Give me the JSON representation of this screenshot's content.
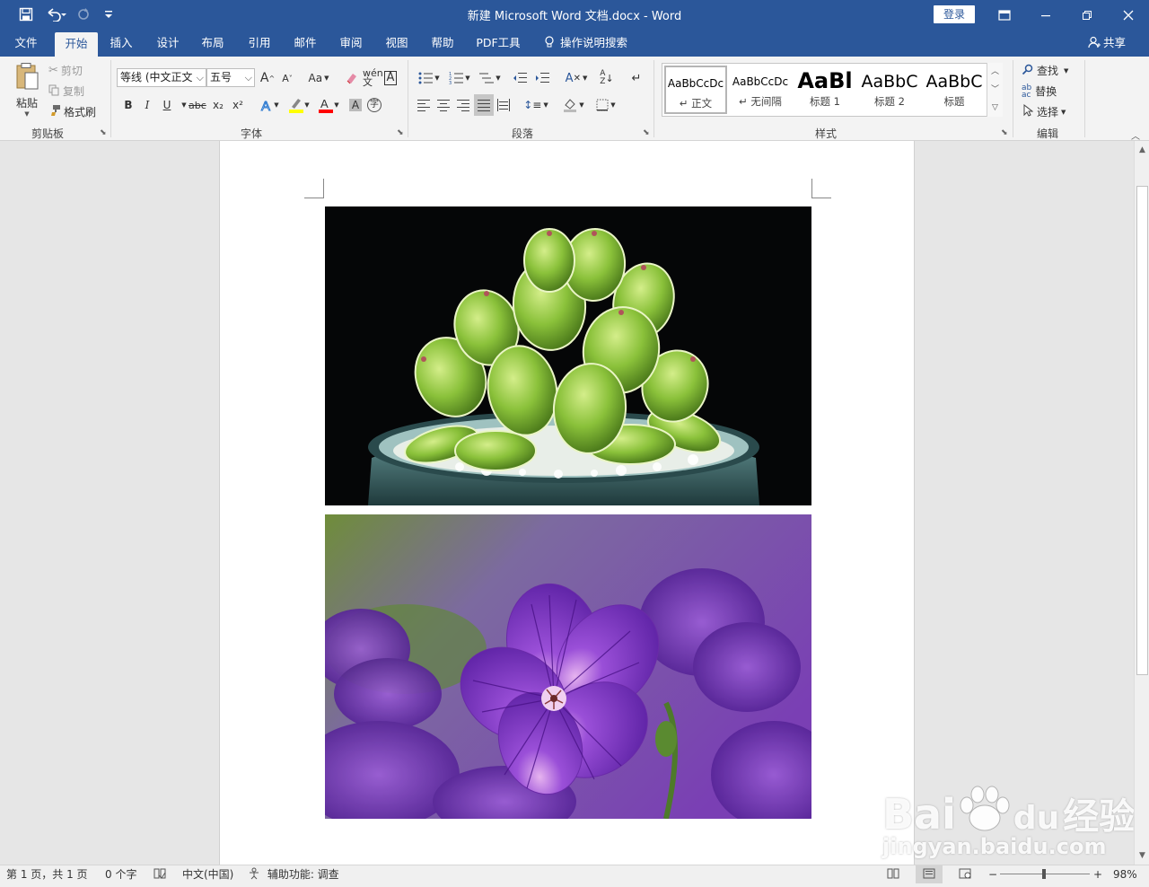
{
  "titlebar": {
    "title": "新建 Microsoft Word 文档.docx  -  Word",
    "login": "登录",
    "qa_icons": [
      "save-icon",
      "undo-icon",
      "redo-icon",
      "customize-icon"
    ]
  },
  "tabs": [
    "文件",
    "开始",
    "插入",
    "设计",
    "布局",
    "引用",
    "邮件",
    "审阅",
    "视图",
    "帮助",
    "PDF工具"
  ],
  "tell_me": "操作说明搜索",
  "share": "共享",
  "clipboard": {
    "paste": "粘贴",
    "cut": "剪切",
    "copy": "复制",
    "format_painter": "格式刷",
    "label": "剪贴板"
  },
  "font": {
    "name": "等线 (中文正文",
    "size": "五号",
    "grow": "A",
    "shrink": "A",
    "case": "Aa",
    "bold": "B",
    "italic": "I",
    "underline": "U",
    "strike": "abc",
    "sub": "x₂",
    "sup": "x²",
    "label": "字体"
  },
  "paragraph": {
    "label": "段落"
  },
  "styles": {
    "items": [
      {
        "preview": "AaBbCcDc",
        "name": "↵ 正文"
      },
      {
        "preview": "AaBbCcDc",
        "name": "↵ 无间隔"
      },
      {
        "preview": "AaBl",
        "name": "标题 1"
      },
      {
        "preview": "AaBbC",
        "name": "标题 2"
      },
      {
        "preview": "AaBbC",
        "name": "标题"
      }
    ],
    "label": "样式"
  },
  "editing": {
    "find": "查找",
    "replace": "替换",
    "select": "选择",
    "label": "编辑"
  },
  "statusbar": {
    "page": "第 1 页，共 1 页",
    "words": "0 个字",
    "language": "中文(中国)",
    "accessibility": "辅助功能: 调查",
    "zoom": "98%",
    "zoom_minus": "−",
    "zoom_plus": "+"
  },
  "watermark": {
    "brand": "Bai",
    "paw": "du",
    "cn": "经验",
    "url": "jingyan.baidu.com"
  },
  "colors": {
    "titlebar": "#2b579a",
    "highlight": "#ffff00",
    "font_red": "#ff0000"
  }
}
